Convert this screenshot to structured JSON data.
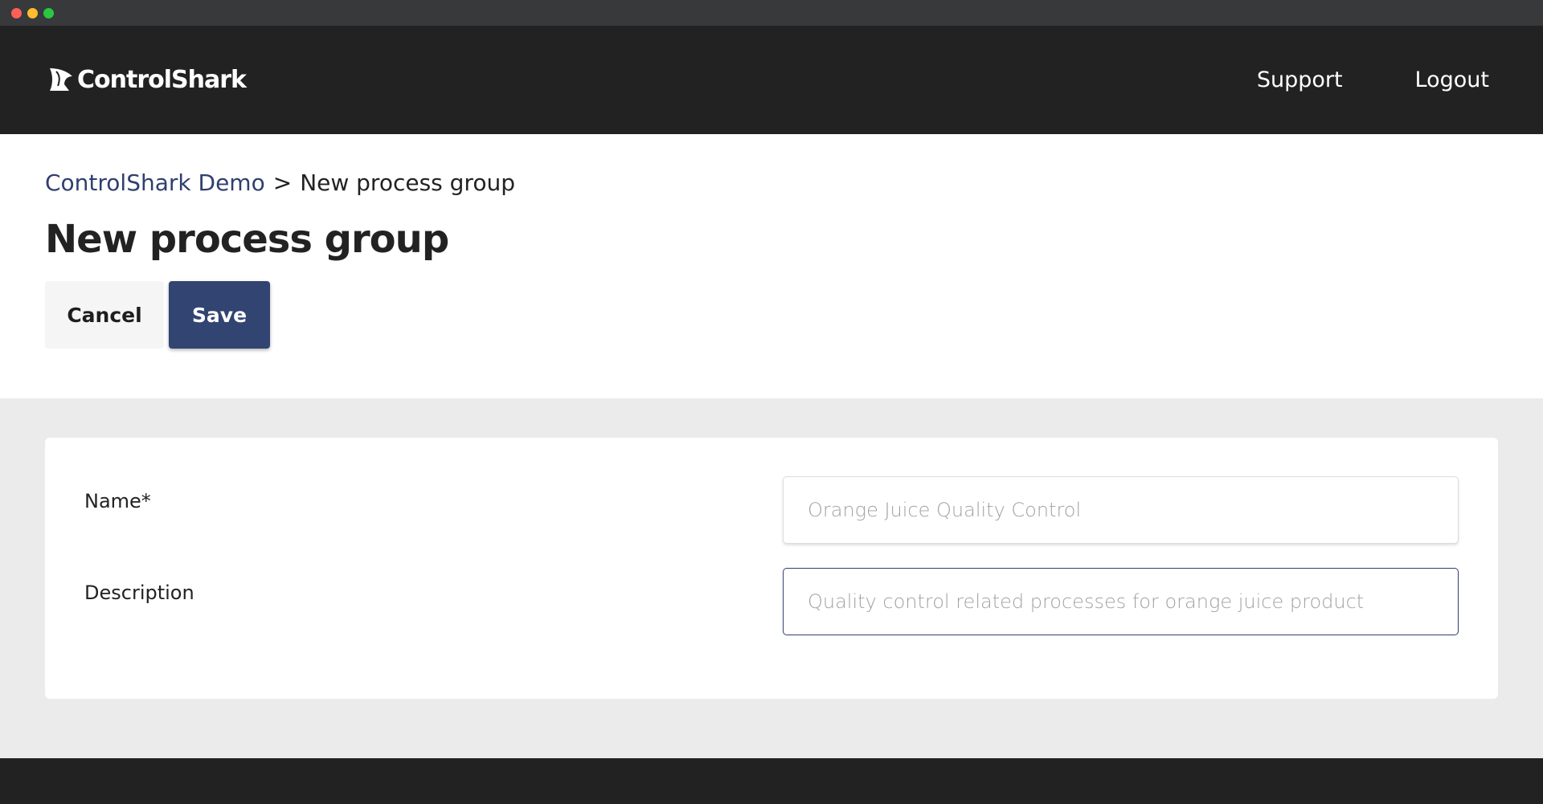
{
  "brand": {
    "name": "ControlShark",
    "icon": "shark-fin-logo-icon"
  },
  "nav": {
    "support": "Support",
    "logout": "Logout"
  },
  "breadcrumb": {
    "parent": "ControlShark Demo",
    "separator": ">",
    "current": "New process group"
  },
  "page": {
    "title": "New process group"
  },
  "actions": {
    "cancel": "Cancel",
    "save": "Save"
  },
  "form": {
    "name": {
      "label": "Name*",
      "placeholder": "Orange Juice Quality Control",
      "value": ""
    },
    "description": {
      "label": "Description",
      "placeholder": "Quality control related processes for orange juice product",
      "value": ""
    }
  },
  "colors": {
    "header_bg": "#222222",
    "primary": "#324471",
    "link": "#2f3f6e",
    "panel_bg": "#ebebeb"
  }
}
